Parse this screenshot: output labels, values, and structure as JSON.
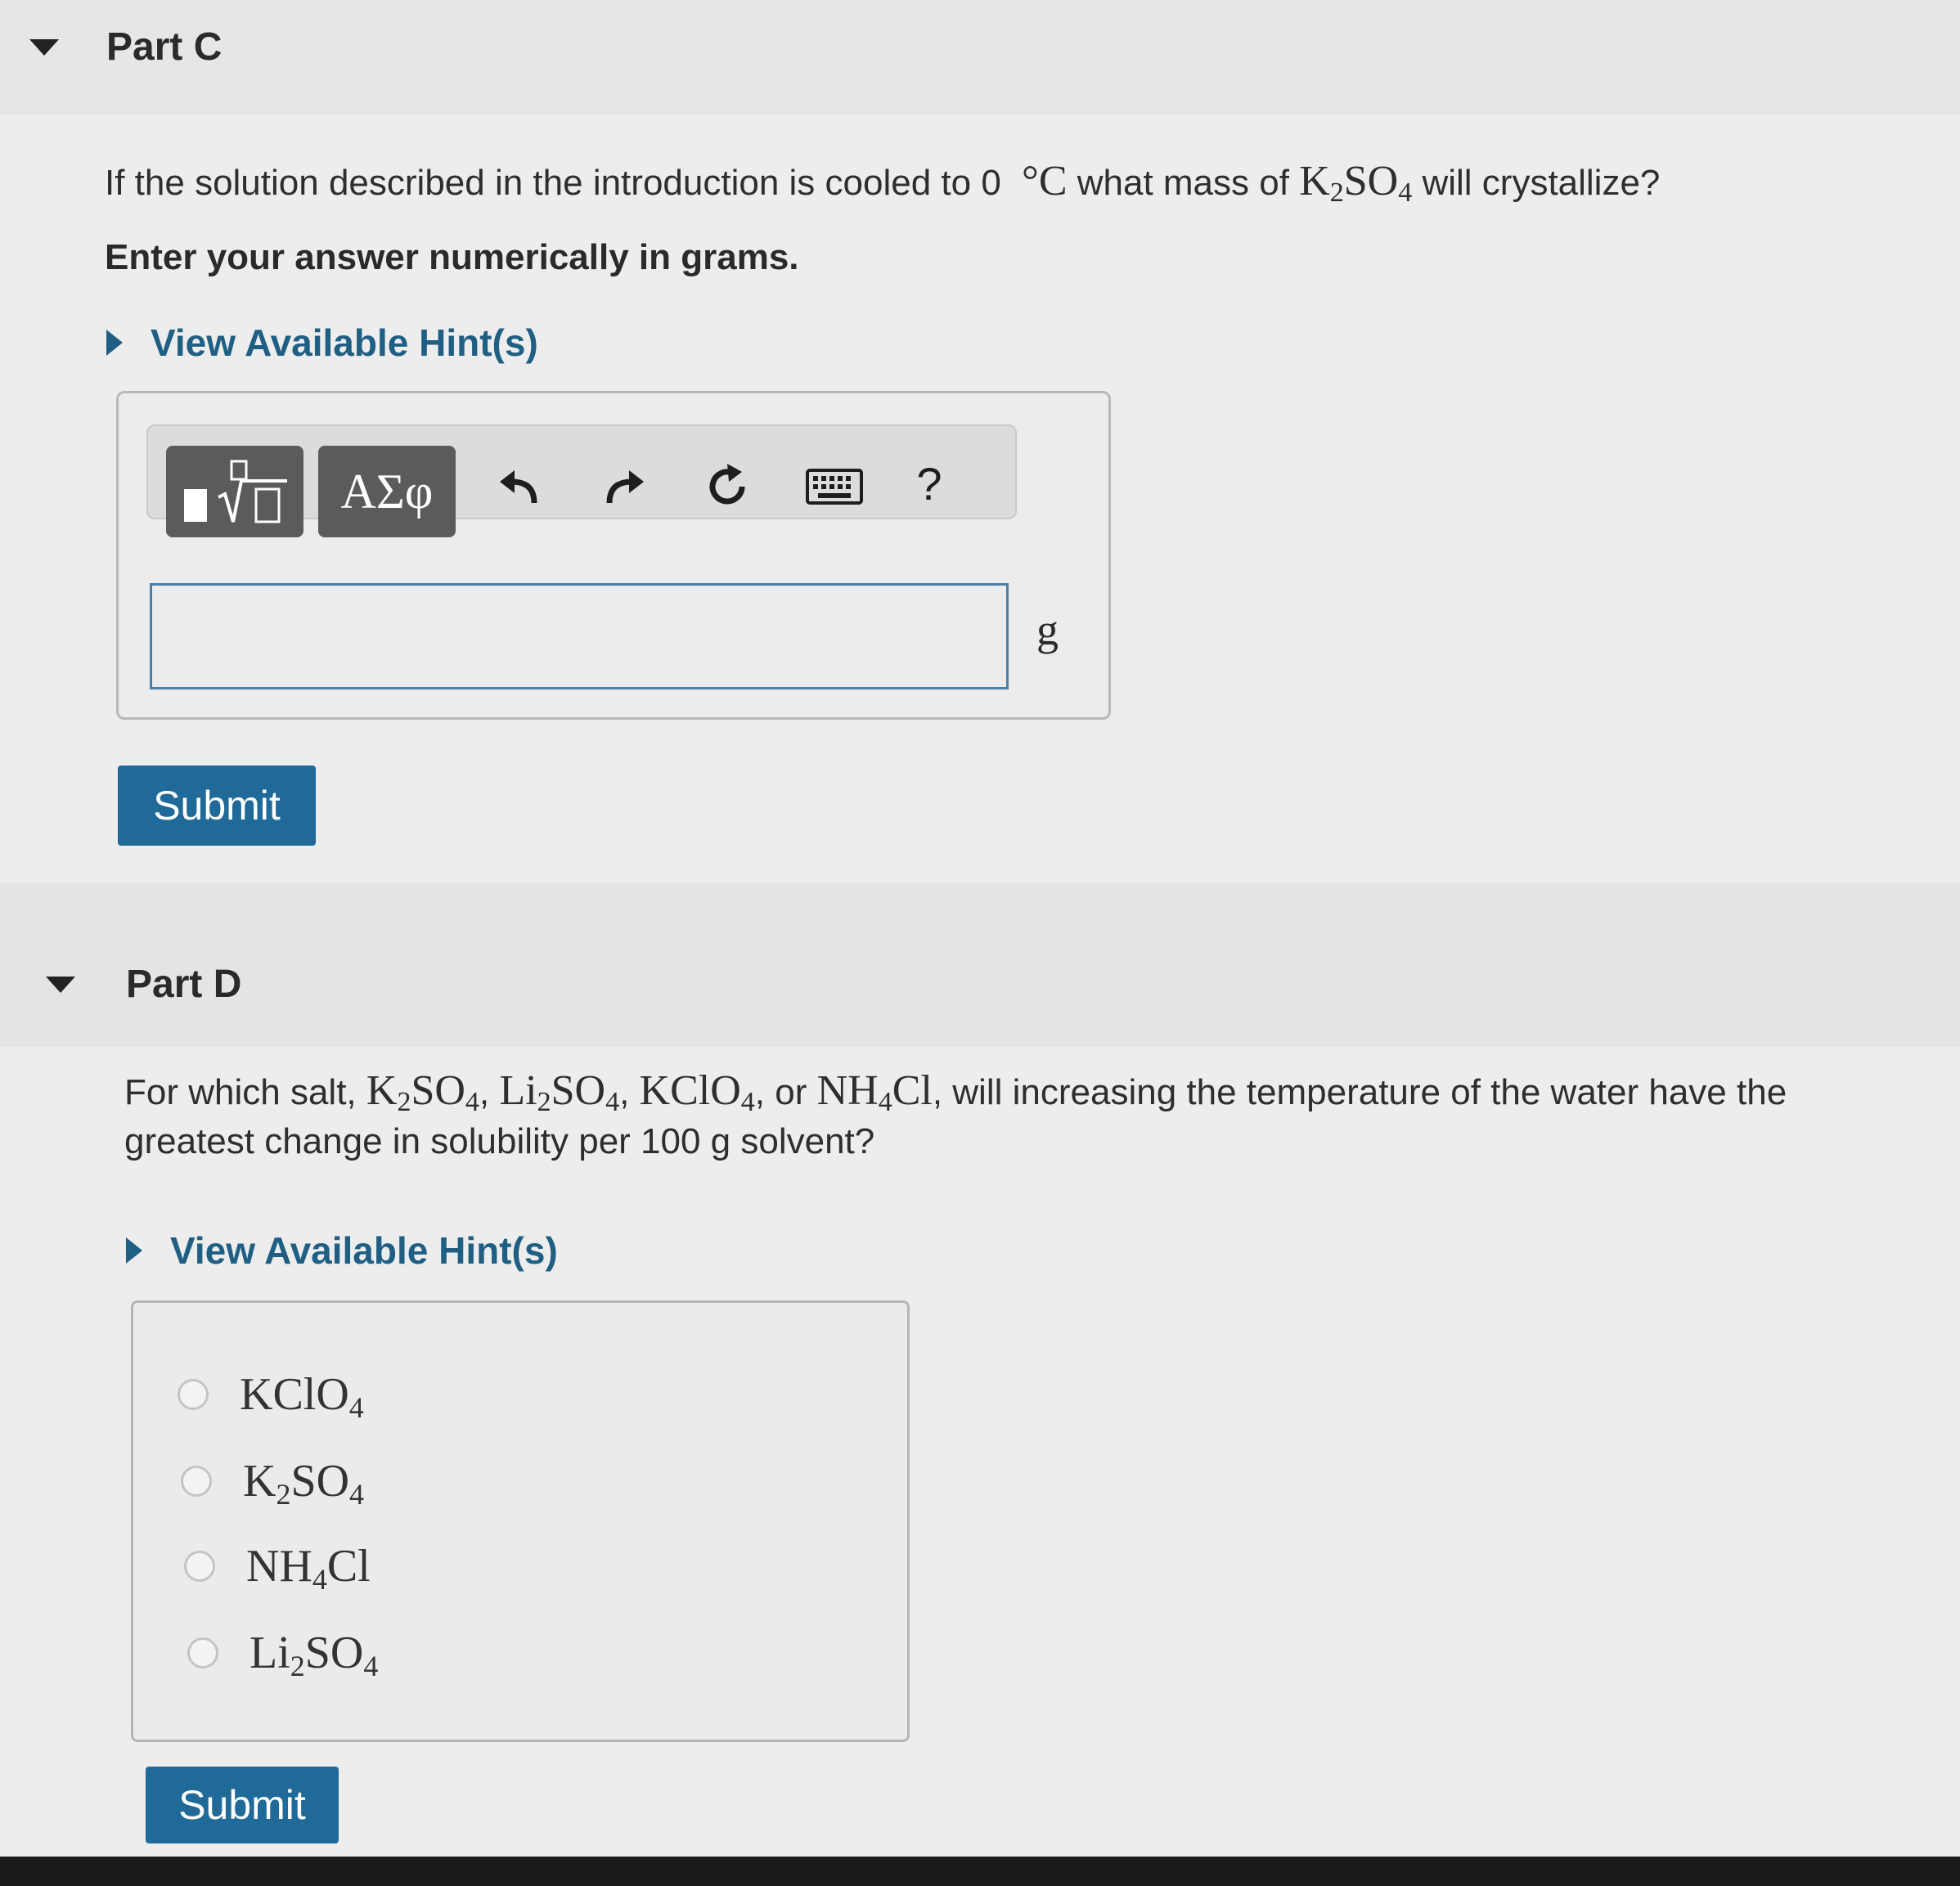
{
  "part_c": {
    "title": "Part C",
    "question": {
      "pre": "If the solution described in the introduction is cooled to 0",
      "temp_unit": "°C",
      "mid": " what mass of ",
      "formula": {
        "k": "K",
        "k_sub": "2",
        "so": "SO",
        "so_sub": "4"
      },
      "post": " will crystallize?"
    },
    "instruction": "Enter your answer numerically in grams.",
    "hint_label": "View Available Hint(s)",
    "toolbar": {
      "templates_label": "√□",
      "greek_label": "ΑΣφ",
      "undo": "↶",
      "redo": "↷",
      "reset": "↻",
      "keyboard": "keyboard",
      "help": "?"
    },
    "answer_value": "",
    "unit": "g",
    "submit_label": "Submit"
  },
  "part_d": {
    "title": "Part D",
    "question": {
      "pre": "For which salt, ",
      "salts_in_text": [
        "K2SO4",
        "Li2SO4",
        "KClO4",
        "NH4Cl"
      ],
      "line1_post": ", will increasing the temperature of the water have the",
      "line2": "greatest change in solubility per 100 g solvent?",
      "or": ", or "
    },
    "hint_label": "View Available Hint(s)",
    "choices": [
      {
        "base": "KClO",
        "sub": "4",
        "rest": ""
      },
      {
        "base": "K",
        "sub": "2",
        "rest": "SO",
        "sub2": "4"
      },
      {
        "base": "NH",
        "sub": "4",
        "rest": "Cl"
      },
      {
        "base": "Li",
        "sub": "2",
        "rest": "SO",
        "sub2": "4"
      }
    ],
    "submit_label": "Submit"
  }
}
